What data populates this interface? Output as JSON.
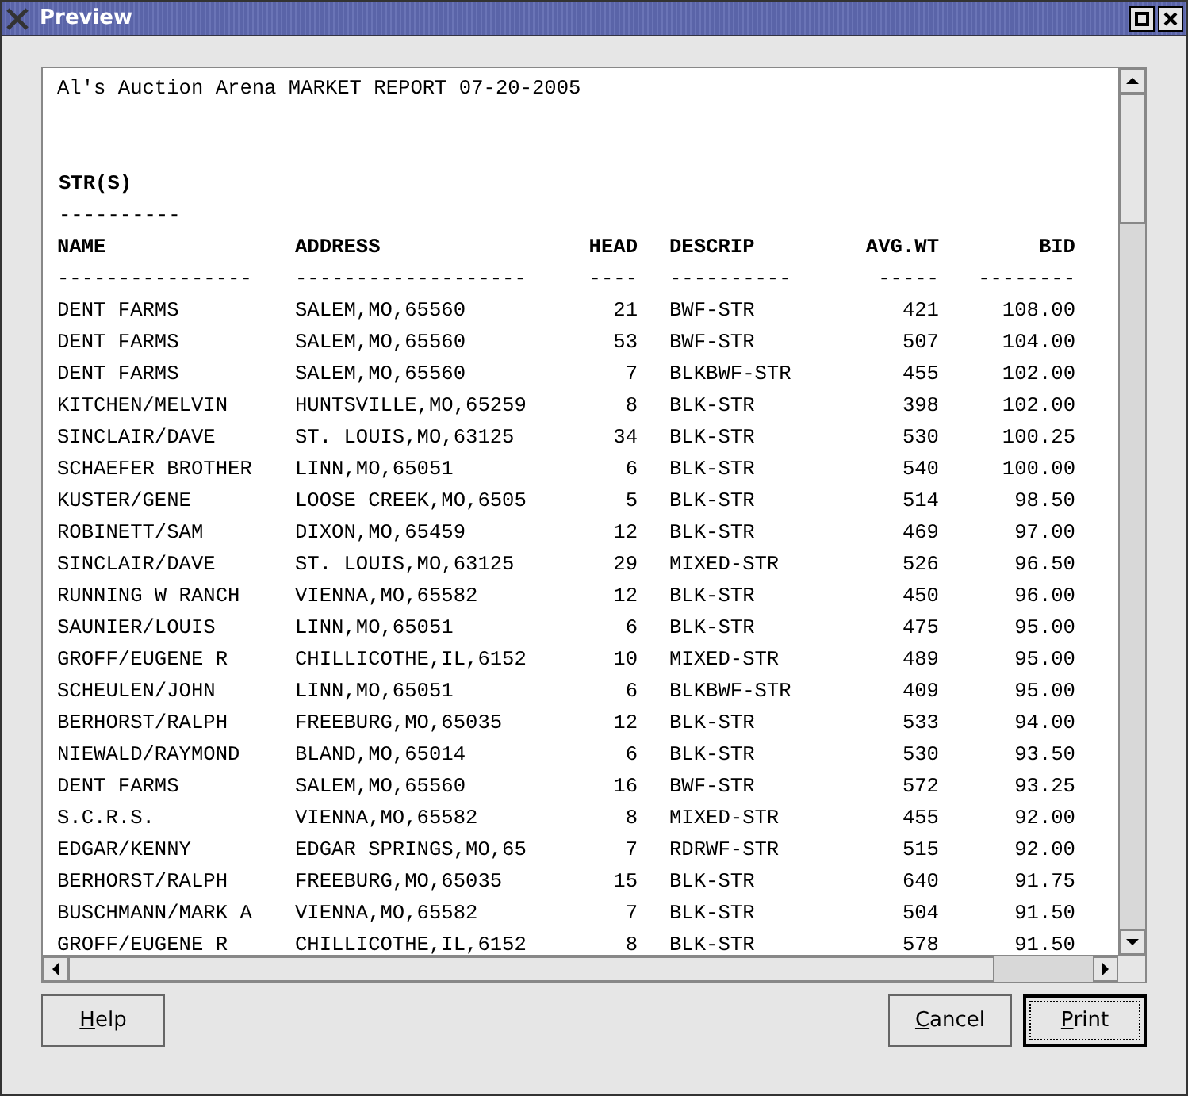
{
  "window": {
    "title": "Preview"
  },
  "report": {
    "title": "Al's Auction Arena MARKET REPORT 07-20-2005",
    "section": "STR(S)",
    "section_rule": "----------",
    "columns": [
      {
        "heading": "NAME",
        "rule": "----------------"
      },
      {
        "heading": "ADDRESS",
        "rule": "-------------------"
      },
      {
        "heading": "HEAD",
        "rule": "----"
      },
      {
        "heading": "DESCRIP",
        "rule": "----------"
      },
      {
        "heading": "AVG.WT",
        "rule": "-----"
      },
      {
        "heading": "BID",
        "rule": "--------"
      }
    ],
    "rows": [
      [
        "DENT FARMS",
        "SALEM,MO,65560",
        "21",
        "BWF-STR",
        "421",
        "108.00"
      ],
      [
        "DENT FARMS",
        "SALEM,MO,65560",
        "53",
        "BWF-STR",
        "507",
        "104.00"
      ],
      [
        "DENT FARMS",
        "SALEM,MO,65560",
        "7",
        "BLKBWF-STR",
        "455",
        "102.00"
      ],
      [
        "KITCHEN/MELVIN",
        "HUNTSVILLE,MO,65259",
        "8",
        "BLK-STR",
        "398",
        "102.00"
      ],
      [
        "SINCLAIR/DAVE",
        "ST. LOUIS,MO,63125",
        "34",
        "BLK-STR",
        "530",
        "100.25"
      ],
      [
        "SCHAEFER BROTHER",
        "LINN,MO,65051",
        "6",
        "BLK-STR",
        "540",
        "100.00"
      ],
      [
        "KUSTER/GENE",
        "LOOSE CREEK,MO,6505",
        "5",
        "BLK-STR",
        "514",
        "98.50"
      ],
      [
        "ROBINETT/SAM",
        "DIXON,MO,65459",
        "12",
        "BLK-STR",
        "469",
        "97.00"
      ],
      [
        "SINCLAIR/DAVE",
        "ST. LOUIS,MO,63125",
        "29",
        "MIXED-STR",
        "526",
        "96.50"
      ],
      [
        "RUNNING W RANCH",
        "VIENNA,MO,65582",
        "12",
        "BLK-STR",
        "450",
        "96.00"
      ],
      [
        "SAUNIER/LOUIS",
        "LINN,MO,65051",
        "6",
        "BLK-STR",
        "475",
        "95.00"
      ],
      [
        "GROFF/EUGENE R",
        "CHILLICOTHE,IL,6152",
        "10",
        "MIXED-STR",
        "489",
        "95.00"
      ],
      [
        "SCHEULEN/JOHN",
        "LINN,MO,65051",
        "6",
        "BLKBWF-STR",
        "409",
        "95.00"
      ],
      [
        "BERHORST/RALPH",
        "FREEBURG,MO,65035",
        "12",
        "BLK-STR",
        "533",
        "94.00"
      ],
      [
        "NIEWALD/RAYMOND",
        "BLAND,MO,65014",
        "6",
        "BLK-STR",
        "530",
        "93.50"
      ],
      [
        "DENT FARMS",
        "SALEM,MO,65560",
        "16",
        "BWF-STR",
        "572",
        "93.25"
      ],
      [
        "S.C.R.S.",
        "VIENNA,MO,65582",
        "8",
        "MIXED-STR",
        "455",
        "92.00"
      ],
      [
        "EDGAR/KENNY",
        "EDGAR SPRINGS,MO,65",
        "7",
        "RDRWF-STR",
        "515",
        "92.00"
      ],
      [
        "BERHORST/RALPH",
        "FREEBURG,MO,65035",
        "15",
        "BLK-STR",
        "640",
        "91.75"
      ],
      [
        "BUSCHMANN/MARK A",
        "VIENNA,MO,65582",
        "7",
        "BLK-STR",
        "504",
        "91.50"
      ],
      [
        "GROFF/EUGENE R",
        "CHILLICOTHE,IL,6152",
        "8",
        "BLK-STR",
        "578",
        "91.50"
      ]
    ]
  },
  "buttons": [
    {
      "key": "H",
      "rest": "elp",
      "default": false
    },
    {
      "key": "C",
      "rest": "ancel",
      "default": false
    },
    {
      "key": "P",
      "rest": "rint",
      "default": true
    }
  ]
}
